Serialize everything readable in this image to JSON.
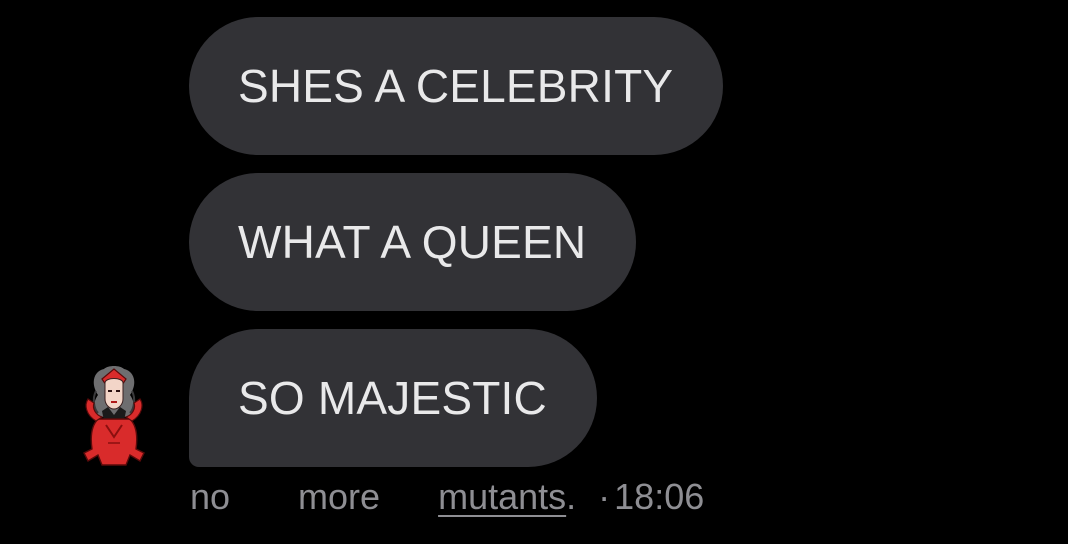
{
  "messages": [
    {
      "text": "SHES A CELEBRITY"
    },
    {
      "text": "WHAT A QUEEN"
    },
    {
      "text": "SO MAJESTIC"
    }
  ],
  "sender": {
    "avatar_icon": "scarlet-witch-avatar-icon"
  },
  "meta": {
    "word1": "no",
    "word2": "more",
    "link_text": "mutants",
    "period": ".",
    "separator": "·",
    "time": "18:06"
  },
  "colors": {
    "background": "#000000",
    "bubble": "#323236",
    "bubble_text": "#e9e9ea",
    "meta_text": "#8e8e93"
  }
}
